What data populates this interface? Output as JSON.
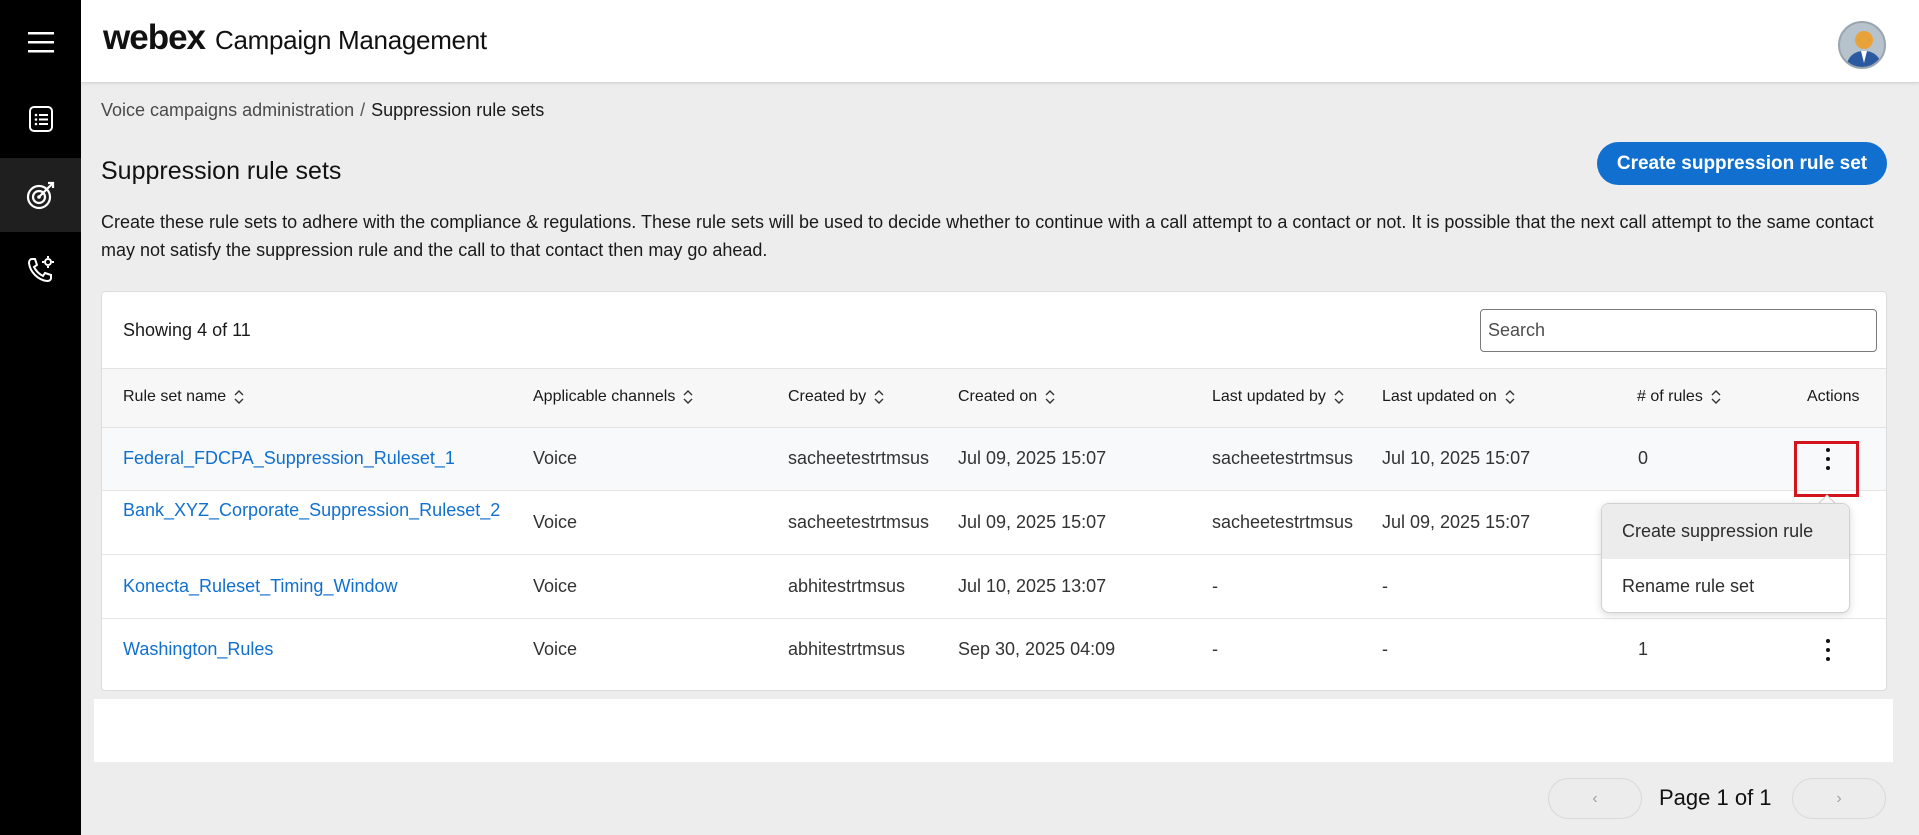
{
  "rail": {
    "items": [
      {
        "icon": "menu-icon"
      },
      {
        "icon": "list-icon"
      },
      {
        "icon": "target-icon"
      },
      {
        "icon": "phone-settings-icon"
      }
    ]
  },
  "header": {
    "logo": "webex",
    "title": "Campaign Management",
    "avatar_icon": "user-avatar-icon"
  },
  "breadcrumb": {
    "parent": "Voice campaigns administration",
    "separator": "/",
    "current": "Suppression rule sets"
  },
  "page": {
    "title": "Suppression rule sets",
    "create_button": "Create suppression rule set",
    "description": "Create these rule sets to adhere with the compliance & regulations. These rule sets will be used to decide whether to continue with a call attempt to a contact or not. It is possible that the next call attempt to the same contact may not satisfy the suppression rule and the call to that contact then may go ahead."
  },
  "table": {
    "showing_label": "Showing",
    "showing_count": "4",
    "showing_of": "of 11",
    "search_placeholder": "Search",
    "columns": [
      "Rule set name",
      "Applicable channels",
      "Created by",
      "Created on",
      "Last updated by",
      "Last updated on",
      "# of rules",
      "Actions"
    ],
    "rows": [
      {
        "name": "Federal_FDCPA_Suppression_Ruleset_1",
        "channels": "Voice",
        "created_by": "sacheetestrtmsus",
        "created_on": "Jul 09, 2025 15:07",
        "updated_by": "sacheetestrtmsus",
        "updated_on": "Jul 10, 2025 15:07",
        "rules": "0"
      },
      {
        "name": "Bank_XYZ_Corporate_Suppression_Ruleset_2",
        "channels": "Voice",
        "created_by": "sacheetestrtmsus",
        "created_on": "Jul 09, 2025 15:07",
        "updated_by": "sacheetestrtmsus",
        "updated_on": "Jul 09, 2025 15:07",
        "rules": ""
      },
      {
        "name": "Konecta_Ruleset_Timing_Window",
        "channels": "Voice",
        "created_by": "abhitestrtmsus",
        "created_on": "Jul 10, 2025 13:07",
        "updated_by": "-",
        "updated_on": "-",
        "rules": ""
      },
      {
        "name": "Washington_Rules",
        "channels": "Voice",
        "created_by": "abhitestrtmsus",
        "created_on": "Sep 30, 2025 04:09",
        "updated_by": "-",
        "updated_on": "-",
        "rules": "1"
      }
    ]
  },
  "actions_menu": {
    "items": [
      "Create suppression rule",
      "Rename rule set"
    ]
  },
  "pagination": {
    "prev": "‹",
    "next": "›",
    "label": "Page 1 of 1"
  }
}
